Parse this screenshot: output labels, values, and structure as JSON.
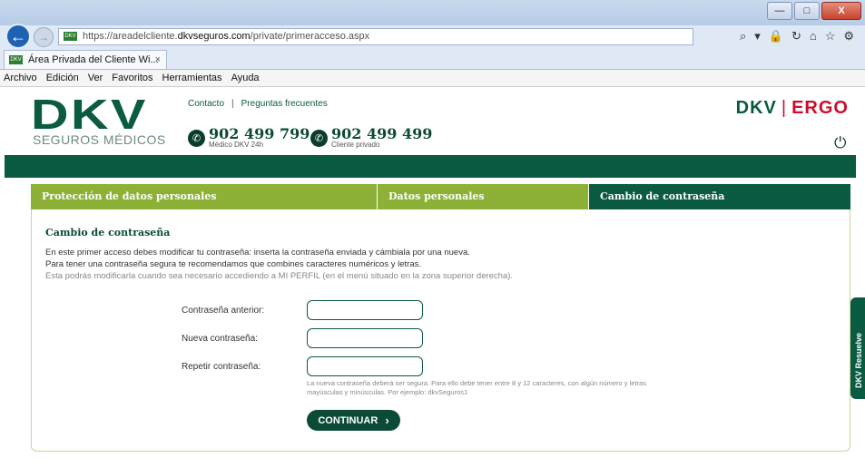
{
  "browser": {
    "url_prefix": "https://areadelcliente.",
    "url_domain": "dkvseguros.com",
    "url_path": "/private/primeracceso.aspx",
    "tab_title": "Área Privada del Cliente Wi...",
    "tab_close": "×",
    "favicon_text": "DKV",
    "window_buttons": {
      "minimize": "—",
      "maximize": "□",
      "close": "X"
    },
    "url_tools": {
      "search": "⌕",
      "dropdown": "▾",
      "lock": "🔒",
      "refresh": "↻"
    },
    "right_icons": {
      "home": "⌂",
      "star": "☆",
      "gear": "⚙"
    },
    "menu": [
      "Archivo",
      "Edición",
      "Ver",
      "Favoritos",
      "Herramientas",
      "Ayuda"
    ]
  },
  "header": {
    "logo_text": "DKV",
    "logo_subtitle": "SEGUROS MÉDICOS",
    "links": {
      "contact": "Contacto",
      "separator": "|",
      "faq": "Preguntas frecuentes"
    },
    "phones": [
      {
        "number": "902 499 799",
        "label": "Médico DKV 24h"
      },
      {
        "number": "902 499 499",
        "label": "Cliente privado"
      }
    ],
    "brand_dkv": "DKV",
    "brand_sep": "|",
    "brand_ergo": "ERGO",
    "power_icon": "⏻"
  },
  "steps": [
    {
      "label": "Protección de datos personales"
    },
    {
      "label": "Datos personales"
    },
    {
      "label": "Cambio de contraseña"
    }
  ],
  "form": {
    "title": "Cambio de contraseña",
    "intro_lines": [
      "En este primer acceso debes modificar tu contraseña: inserta la contraseña enviada y cámbiala por una nueva.",
      "Para tener una contraseña segura te recomendamos que combines caracteres numéricos y letras.",
      "Esta podrás modificarla cuando sea necesario accediendo a MI PERFIL (en el menú situado en la zona superior derecha)."
    ],
    "fields": {
      "old_password_label": "Contraseña anterior:",
      "new_password_label": "Nueva contraseña:",
      "repeat_password_label": "Repetir contraseña:",
      "old_password_value": "",
      "new_password_value": "",
      "repeat_password_value": ""
    },
    "hint_lines": [
      "La nueva contraseña deberá ser segura. Para ello debe tener entre 8 y 12 caracteres, con algún número y letras",
      "mayúsculas y minúsculas. Por ejemplo: dkvSeguros1"
    ],
    "continue_label": "CONTINUAR",
    "continue_chevron": "›"
  },
  "side_tab": {
    "label": "DKV Resuelve"
  },
  "colors": {
    "brand_green": "#0b5a42",
    "accent_green": "#8db036",
    "ergo_red": "#c8102e"
  }
}
